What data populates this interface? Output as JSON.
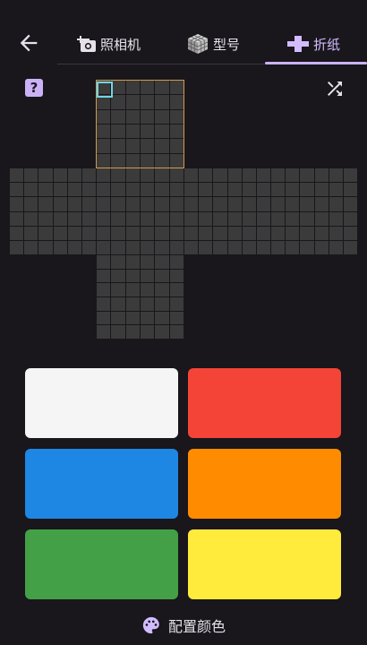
{
  "header": {
    "tabs": [
      {
        "label": "照相机",
        "icon": "camera-add-icon"
      },
      {
        "label": "型号",
        "icon": "cube-icon"
      },
      {
        "label": "折纸",
        "icon": "cross-net-icon",
        "active": true
      }
    ]
  },
  "toolbar": {
    "help_label": "?"
  },
  "palette": {
    "colors": [
      {
        "name": "white",
        "hex": "#f5f5f5"
      },
      {
        "name": "red",
        "hex": "#f44437"
      },
      {
        "name": "blue",
        "hex": "#1e87e3"
      },
      {
        "name": "orange",
        "hex": "#ff8c00"
      },
      {
        "name": "green",
        "hex": "#43a047"
      },
      {
        "name": "yellow",
        "hex": "#ffeb3b"
      }
    ]
  },
  "footer": {
    "configure_colors_label": "配置颜色"
  },
  "colors": {
    "background": "#19161c",
    "accent": "#cbb2f6",
    "sticker_empty": "#3b3b3b",
    "face_highlight": "#d39a4c",
    "cell_cursor": "#6fd6e6"
  }
}
